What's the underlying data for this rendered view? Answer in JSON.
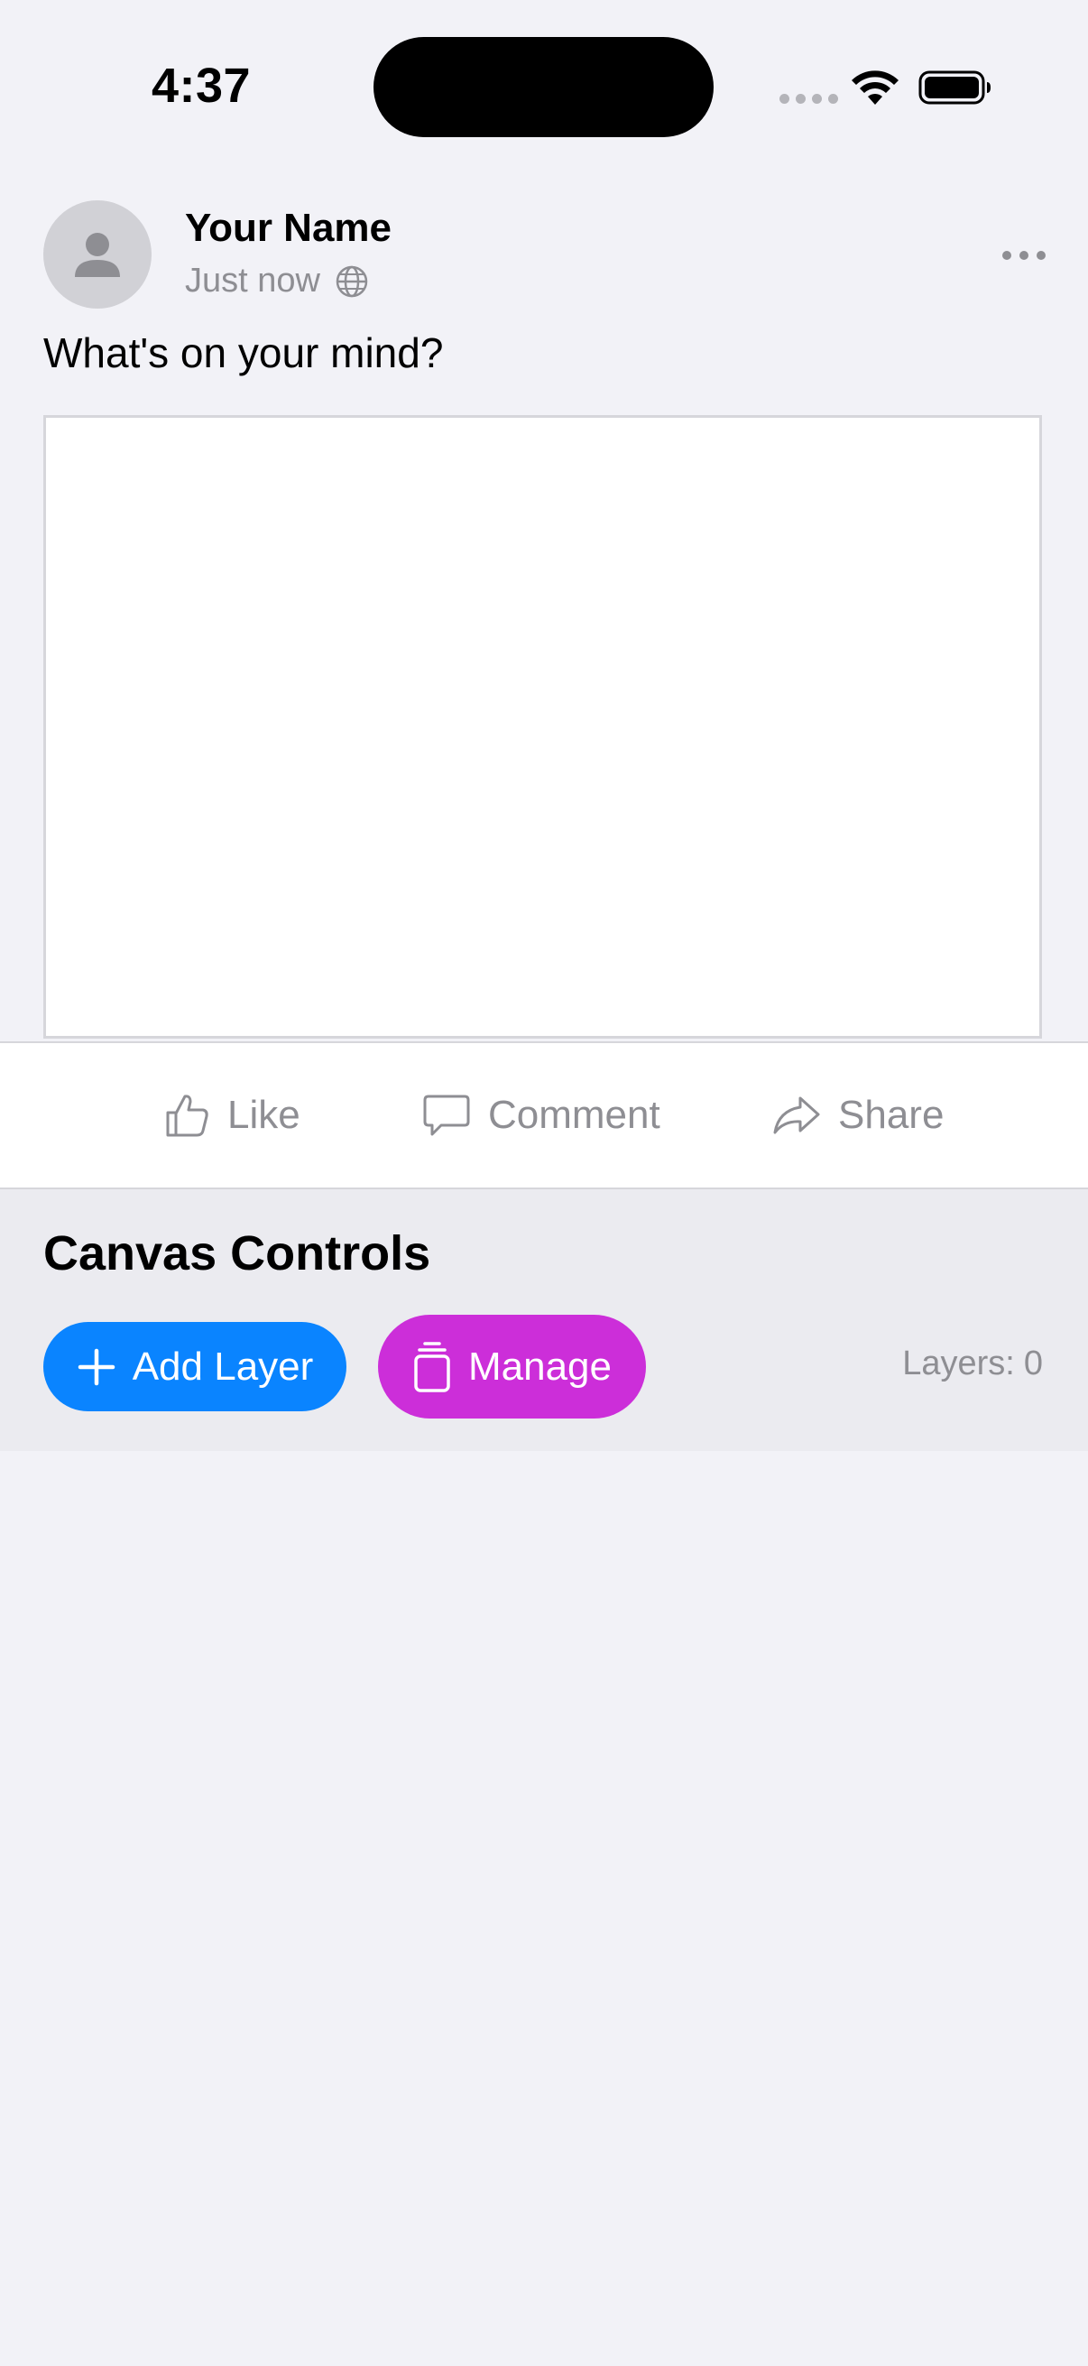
{
  "status_bar": {
    "time": "4:37"
  },
  "post": {
    "author_name": "Your Name",
    "timestamp": "Just now",
    "visibility_icon": "globe-icon",
    "prompt": "What's on your mind?",
    "more_icon": "ellipsis-icon"
  },
  "actions": {
    "like": "Like",
    "comment": "Comment",
    "share": "Share"
  },
  "canvas_controls": {
    "title": "Canvas Controls",
    "add_layer": "Add Layer",
    "manage": "Manage",
    "layers_label": "Layers:",
    "layers_count": "0"
  },
  "colors": {
    "background": "#f2f2f7",
    "accent_blue": "#0a84ff",
    "accent_magenta": "#cc2ed9",
    "secondary_text": "#8e8e93"
  }
}
